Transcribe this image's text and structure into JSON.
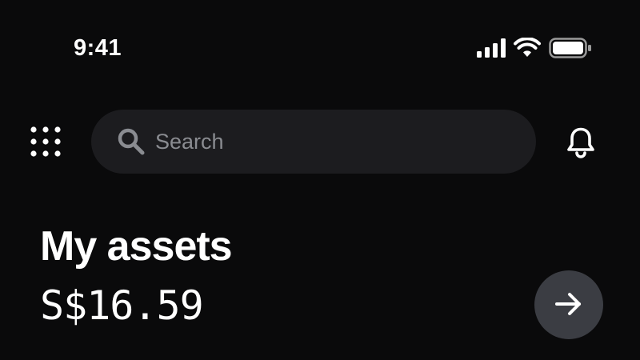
{
  "status_bar": {
    "time": "9:41",
    "icons": [
      "cellular-signal-icon",
      "wifi-icon",
      "battery-icon"
    ]
  },
  "header": {
    "menu_icon": "grid-dots-icon",
    "search": {
      "placeholder": "Search",
      "value": "",
      "icon": "search-icon"
    },
    "notifications_icon": "bell-icon"
  },
  "assets": {
    "title": "My assets",
    "total_value": "S$16.59",
    "action_icon": "arrow-right-icon"
  },
  "colors": {
    "background": "#0a0a0b",
    "search_bg": "#1c1c1f",
    "placeholder": "#8a8c91",
    "action_button_bg": "#3b3d43",
    "text": "#ffffff"
  }
}
